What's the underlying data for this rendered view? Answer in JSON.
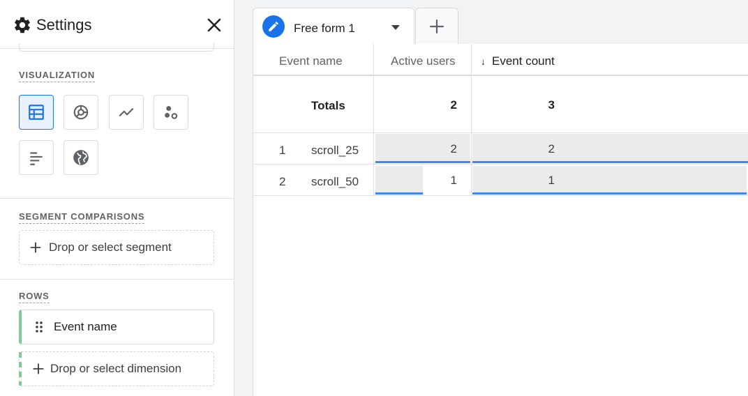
{
  "settings": {
    "title": "Settings",
    "visualization_label": "VISUALIZATION",
    "visualization_types": [
      {
        "icon": "table-icon",
        "selected": true
      },
      {
        "icon": "donut-chart-icon",
        "selected": false
      },
      {
        "icon": "line-chart-icon",
        "selected": false
      },
      {
        "icon": "scatter-plot-icon",
        "selected": false
      },
      {
        "icon": "bar-chart-icon",
        "selected": false
      },
      {
        "icon": "globe-icon",
        "selected": false
      }
    ],
    "segment_label": "SEGMENT COMPARISONS",
    "segment_drop": "Drop or select segment",
    "rows_label": "ROWS",
    "row_dimension": "Event name",
    "dimension_drop": "Drop or select dimension"
  },
  "tabs": {
    "active_label": "Free form 1"
  },
  "table": {
    "columns": [
      "Event name",
      "Active users",
      "Event count"
    ],
    "sort_indicator": "↓",
    "totals": {
      "label": "Totals",
      "active_users": "2",
      "event_count": "3"
    },
    "rows": [
      {
        "index": "1",
        "event_name": "scroll_25",
        "active_users": "2",
        "event_count": "2",
        "active_users_fraction": 1.0,
        "event_count_fraction": 1.0
      },
      {
        "index": "2",
        "event_name": "scroll_50",
        "active_users": "1",
        "event_count": "1",
        "active_users_fraction": 0.5,
        "event_count_fraction": 1.0
      }
    ]
  },
  "colors": {
    "accent": "#1a73e8",
    "bar_line": "#4285f4",
    "row_chip": "#81c995"
  }
}
